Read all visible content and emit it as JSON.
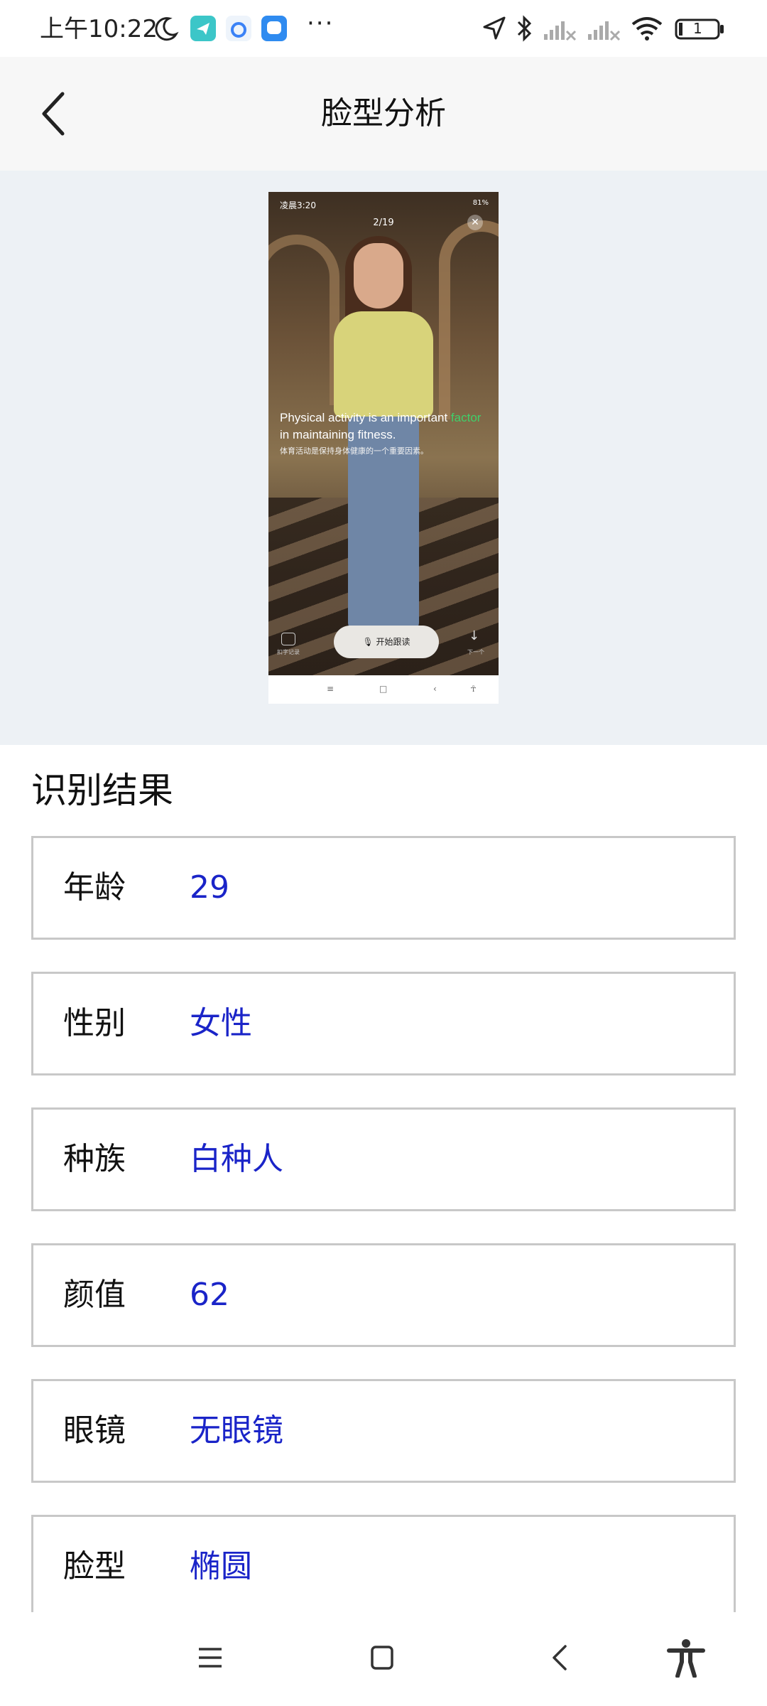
{
  "status_bar": {
    "time": "上午10:22",
    "battery": "1",
    "icons": [
      "moon-icon",
      "telegram-app-icon",
      "browser-app-icon",
      "chat-app-icon",
      "more-dots",
      "location-icon",
      "bluetooth-icon",
      "signal-icon",
      "signal-icon",
      "wifi-icon",
      "battery-icon"
    ],
    "more": "···"
  },
  "header": {
    "title": "脸型分析",
    "back_icon": "chevron-left-icon"
  },
  "preview": {
    "status_time": "凌晨3:20",
    "status_right": "81%",
    "counter": "2/19",
    "subtitle_en_pre": "Physical activity is an important ",
    "subtitle_en_highlight": "factor",
    "subtitle_en_post": " in maintaining fitness.",
    "subtitle_cn": "体育活动是保持身体健康的一个重要因素。",
    "mic_button": "开始跟读",
    "left_label": "扣字记录",
    "right_label": "下一个",
    "highlight_color": "#3fd06a"
  },
  "results": {
    "title": "识别结果",
    "items": [
      {
        "label": "年龄",
        "value": "29"
      },
      {
        "label": "性别",
        "value": "女性"
      },
      {
        "label": "种族",
        "value": "白种人"
      },
      {
        "label": "颜值",
        "value": "62"
      },
      {
        "label": "眼镜",
        "value": "无眼镜"
      },
      {
        "label": "脸型",
        "value": "椭圆"
      }
    ],
    "value_color": "#1a24c8"
  },
  "navbar": {
    "icons": [
      "menu-icon",
      "home-icon",
      "back-icon",
      "accessibility-icon"
    ]
  }
}
